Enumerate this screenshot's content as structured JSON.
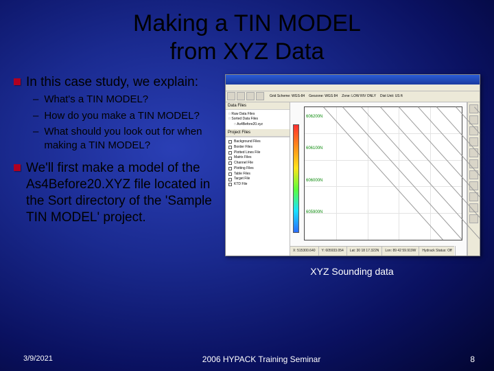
{
  "title_line1": "Making a TIN MODEL",
  "title_line2": "from XYZ Data",
  "bullet1": "In this case study, we explain:",
  "sub": [
    "What's a TIN MODEL?",
    "How do you make a TIN MODEL?",
    "What should you look out for when making a TIN MODEL?"
  ],
  "bullet2": "We'll first make a model of the As4Before20.XYZ file located in the Sort directory of the 'Sample TIN MODEL' project.",
  "caption": "XYZ Sounding data",
  "date": "3/9/2021",
  "seminar": "2006 HYPACK Training Seminar",
  "page": "8",
  "screenshot": {
    "tree": [
      "Raw Data Files",
      "Sorted Data Files",
      "As4Before20.xyz"
    ],
    "project_panel": "Project Files",
    "files": [
      "Background Files",
      "Border Files",
      "Plotted Lines File",
      "Matrix Files",
      "Channel File",
      "Plotting Files",
      "Table Files",
      "Target File",
      "KTD File"
    ],
    "topbar": [
      "Grid Scheme: WGS-84",
      "Geozone: WGS 84",
      "Zone: LOW RIV ONLY",
      "Dist Unit: US ft"
    ],
    "ylabels": [
      "606200N",
      "606100N",
      "606000N",
      "605900N"
    ],
    "status": [
      "X: 515300.640",
      "Y: 605933.054",
      "Lat: 30 18 17.322N",
      "Lon: 89 42 59.919W",
      "Hydrack Status: Off"
    ]
  }
}
